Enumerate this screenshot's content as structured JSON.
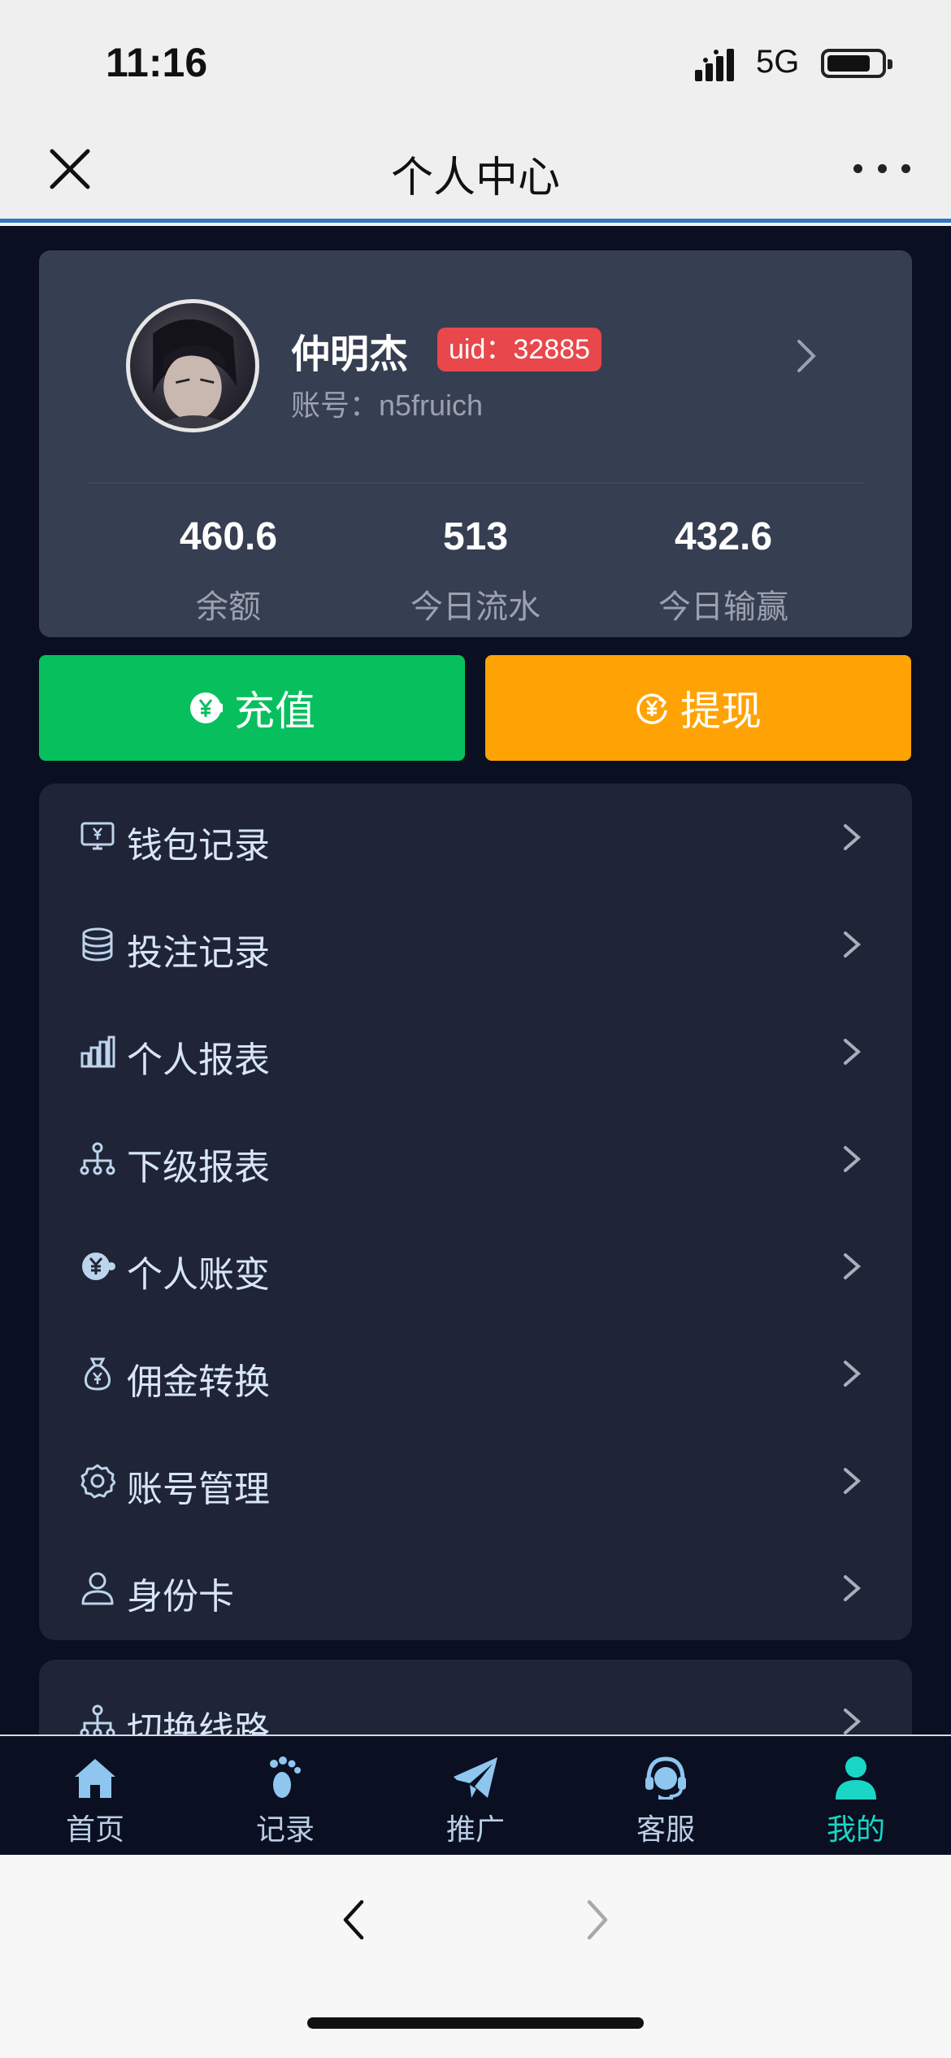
{
  "status_bar": {
    "time": "11:16",
    "network": "5G"
  },
  "navbar": {
    "title": "个人中心"
  },
  "profile": {
    "name": "仲明杰",
    "uid_badge": "uid：32885",
    "account": "账号：n5fruich",
    "stats": [
      {
        "value": "460.6",
        "label": "余额"
      },
      {
        "value": "513",
        "label": "今日流水"
      },
      {
        "value": "432.6",
        "label": "今日输赢"
      }
    ]
  },
  "actions": {
    "recharge": "充值",
    "withdraw": "提现"
  },
  "menu": {
    "items": [
      {
        "label": "钱包记录",
        "icon": "wallet-monitor-icon"
      },
      {
        "label": "投注记录",
        "icon": "database-icon"
      },
      {
        "label": "个人报表",
        "icon": "bar-chart-icon"
      },
      {
        "label": "下级报表",
        "icon": "org-tree-icon"
      },
      {
        "label": "个人账变",
        "icon": "yen-coin-icon"
      },
      {
        "label": "佣金转换",
        "icon": "money-bag-icon"
      },
      {
        "label": "账号管理",
        "icon": "gear-icon"
      },
      {
        "label": "身份卡",
        "icon": "user-icon"
      }
    ],
    "secondary": [
      {
        "label": "切换线路",
        "icon": "org-tree-icon"
      }
    ]
  },
  "tabbar": {
    "tabs": [
      {
        "label": "首页",
        "icon": "home-icon"
      },
      {
        "label": "记录",
        "icon": "footprint-icon"
      },
      {
        "label": "推广",
        "icon": "paper-plane-icon"
      },
      {
        "label": "客服",
        "icon": "headset-icon"
      },
      {
        "label": "我的",
        "icon": "user-icon",
        "active": true
      }
    ]
  },
  "colors": {
    "recharge": "#08bf5e",
    "withdraw": "#ffa305",
    "uid_badge": "#e8474c",
    "active_tab": "#19d6c6"
  }
}
